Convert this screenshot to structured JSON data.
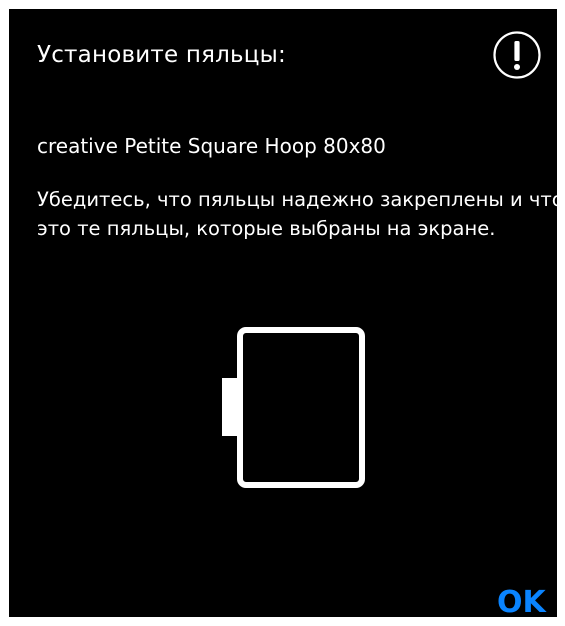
{
  "dialog": {
    "title": "Установите пяльцы:",
    "hoop_name": "creative Petite Square Hoop 80x80",
    "instruction": "Убедитесь, что пяльцы надежно закреплены и что это те пяльцы, которые выбраны на экране.",
    "ok_label": "OK"
  },
  "icons": {
    "warning": "exclamation-circle-icon",
    "hoop": "square-hoop-icon"
  },
  "colors": {
    "background": "#000000",
    "text": "#ffffff",
    "accent": "#0a84ff"
  }
}
